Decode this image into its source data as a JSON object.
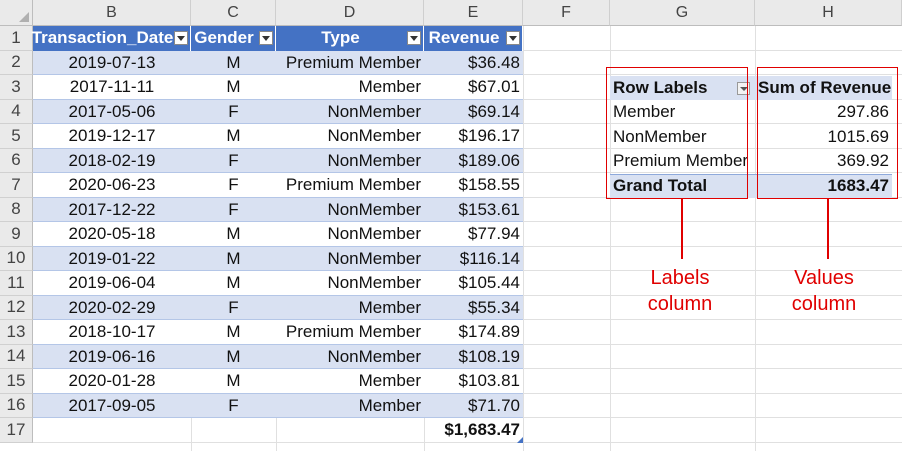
{
  "columns": [
    "B",
    "C",
    "D",
    "E",
    "F",
    "G",
    "H"
  ],
  "rows": [
    "1",
    "2",
    "3",
    "4",
    "5",
    "6",
    "7",
    "8",
    "9",
    "10",
    "11",
    "12",
    "13",
    "14",
    "15",
    "16",
    "17"
  ],
  "table": {
    "headers": [
      "Transaction_Date",
      "Gender",
      "Type",
      "Revenue"
    ],
    "records": [
      [
        "2019-07-13",
        "M",
        "Premium Member",
        "$36.48"
      ],
      [
        "2017-11-11",
        "M",
        "Member",
        "$67.01"
      ],
      [
        "2017-05-06",
        "F",
        "NonMember",
        "$69.14"
      ],
      [
        "2019-12-17",
        "M",
        "NonMember",
        "$196.17"
      ],
      [
        "2018-02-19",
        "F",
        "NonMember",
        "$189.06"
      ],
      [
        "2020-06-23",
        "F",
        "Premium Member",
        "$158.55"
      ],
      [
        "2017-12-22",
        "F",
        "NonMember",
        "$153.61"
      ],
      [
        "2020-05-18",
        "M",
        "NonMember",
        "$77.94"
      ],
      [
        "2019-01-22",
        "M",
        "NonMember",
        "$116.14"
      ],
      [
        "2019-06-04",
        "M",
        "NonMember",
        "$105.44"
      ],
      [
        "2020-02-29",
        "F",
        "Member",
        "$55.34"
      ],
      [
        "2018-10-17",
        "M",
        "Premium Member",
        "$174.89"
      ],
      [
        "2019-06-16",
        "M",
        "NonMember",
        "$108.19"
      ],
      [
        "2020-01-28",
        "M",
        "Member",
        "$103.81"
      ],
      [
        "2017-09-05",
        "F",
        "Member",
        "$71.70"
      ]
    ],
    "total": "$1,683.47"
  },
  "pivot": {
    "header_labels": "Row Labels",
    "header_values": "Sum of Revenue",
    "rows": [
      {
        "label": "Member",
        "value": "297.86"
      },
      {
        "label": "NonMember",
        "value": "1015.69"
      },
      {
        "label": "Premium Member",
        "value": "369.92"
      }
    ],
    "total_label": "Grand Total",
    "total_value": "1683.47"
  },
  "annotations": {
    "labels_line1": "Labels",
    "labels_line2": "column",
    "values_line1": "Values",
    "values_line2": "column"
  },
  "colors": {
    "table_header": "#4472c4",
    "band": "#d9e1f2",
    "annotation": "#e00000"
  }
}
